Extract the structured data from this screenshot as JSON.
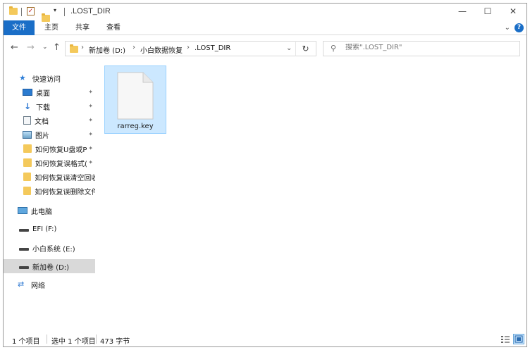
{
  "window": {
    "title": ".LOST_DIR",
    "minimize_glyph": "—",
    "maximize_glyph": "☐",
    "close_glyph": "✕"
  },
  "ribbon": {
    "tabs": [
      "文件",
      "主页",
      "共享",
      "查看"
    ],
    "expand_glyph": "⌄",
    "help_glyph": "?"
  },
  "nav": {
    "back_glyph": "←",
    "forward_glyph": "→",
    "recent_glyph": "⌄",
    "up_glyph": "↑",
    "breadcrumb": [
      "新加卷 (D:)",
      "小白数据恢复",
      ".LOST_DIR"
    ],
    "breadcrumb_sep": "›",
    "address_dropdown_glyph": "⌄",
    "refresh_glyph": "↻"
  },
  "search": {
    "placeholder": "搜索\".LOST_DIR\"",
    "icon_glyph": "⚲"
  },
  "sidebar": {
    "items": [
      {
        "label": "快速访问"
      },
      {
        "label": "桌面",
        "pinned": true
      },
      {
        "label": "下载",
        "pinned": true
      },
      {
        "label": "文档",
        "pinned": true
      },
      {
        "label": "图片",
        "pinned": true
      },
      {
        "label": "如何恢复U盘或P",
        "pinned": true
      },
      {
        "label": "如何恢复误格式(",
        "pinned": true
      },
      {
        "label": "如何恢复误清空回收"
      },
      {
        "label": "如何恢复误删除文件"
      },
      {
        "label": "此电脑"
      },
      {
        "label": "EFI (F:)"
      },
      {
        "label": "小白系统 (E:)"
      },
      {
        "label": "新加卷 (D:)",
        "selected": true
      },
      {
        "label": "网络"
      }
    ],
    "pin_glyph": "📌"
  },
  "content": {
    "files": [
      {
        "name": "rarreg.key",
        "selected": true
      }
    ]
  },
  "status": {
    "item_count": "1 个项目",
    "selected": "选中 1 个项目",
    "size": "473 字节"
  },
  "colors": {
    "accent": "#1a6ec7",
    "selection_bg": "#cce8ff",
    "selection_border": "#99d1ff"
  }
}
